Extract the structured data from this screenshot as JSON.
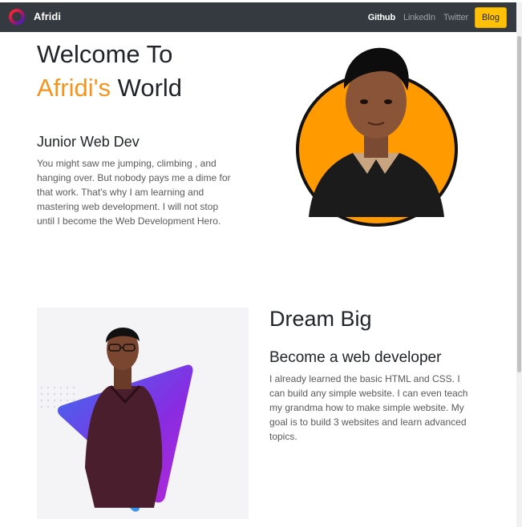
{
  "navbar": {
    "brand": "Afridi",
    "links": [
      {
        "label": "Github",
        "active": true
      },
      {
        "label": "LinkedIn",
        "active": false
      },
      {
        "label": "Twitter",
        "active": false
      }
    ],
    "blog_button": "Blog",
    "colors": {
      "bar": "#343a40",
      "button": "#ffc107"
    }
  },
  "hero": {
    "title_line1": "Welcome To",
    "title_accent": "Afridi's",
    "title_rest": " World",
    "subtitle": "Junior Web Dev",
    "paragraph": "You might saw me jumping, climbing , and hanging over. But nobody pays me a dime for that work. That's why I am learning and mastering web development. I will not stop until I become the Web Development Hero.",
    "accent_color": "#f7941d",
    "profile_circle_color": "#ff9a00"
  },
  "dream": {
    "title": "Dream Big",
    "subtitle": "Become a web developer",
    "paragraph": "I already learned the basic HTML and CSS. I can build any simple website. I can even teach my grandma how to make simple website. My goal is to build 3 websites and learn advanced topics."
  },
  "icons": {
    "brand_logo": "ring-logo-icon"
  }
}
